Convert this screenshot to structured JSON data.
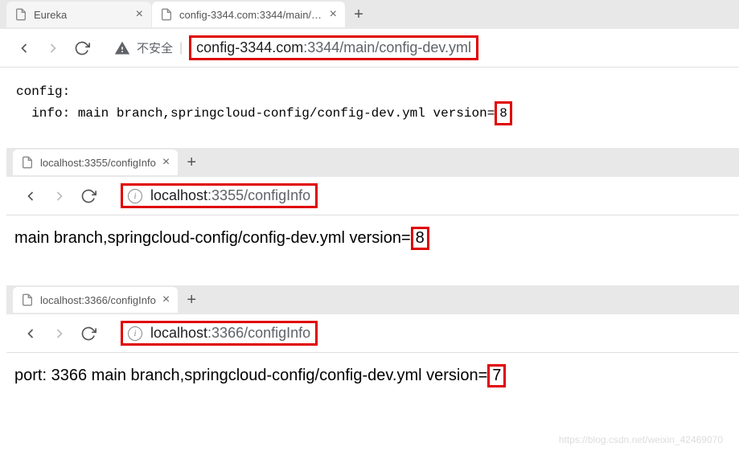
{
  "browser1": {
    "tabs": [
      {
        "title": "Eureka",
        "active": false
      },
      {
        "title": "config-3344.com:3344/main/con",
        "active": true
      }
    ],
    "security_label": "不安全",
    "url_host": "config-3344.com",
    "url_port": ":3344",
    "url_path": "/main/config-dev.yml",
    "content_prefix": "config:\n  info: main branch,springcloud-config/config-dev.yml version=",
    "content_version": "8"
  },
  "browser2": {
    "tabs": [
      {
        "title": "localhost:3355/configInfo",
        "active": true
      }
    ],
    "url_host": "localhost",
    "url_port": ":3355",
    "url_path": "/configInfo",
    "content_prefix": "main branch,springcloud-config/config-dev.yml version=",
    "content_version": "8"
  },
  "browser3": {
    "tabs": [
      {
        "title": "localhost:3366/configInfo",
        "active": true
      }
    ],
    "url_host": "localhost",
    "url_port": ":3366",
    "url_path": "/configInfo",
    "content_prefix": "port: 3366 main branch,springcloud-config/config-dev.yml version=",
    "content_version": "7"
  },
  "watermark": "https://blog.csdn.net/weixin_42469070"
}
